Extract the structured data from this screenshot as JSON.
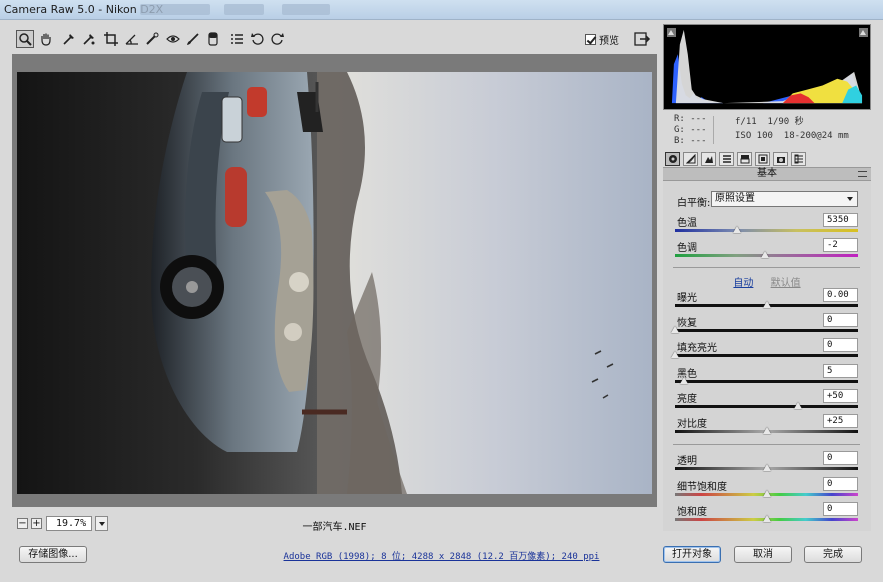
{
  "window": {
    "title": "Camera Raw 5.0 - Nikon D2X"
  },
  "toolbar": {
    "tools": [
      "zoom-tool-icon",
      "hand-tool-icon",
      "white-balance-icon",
      "color-sampler-icon",
      "crop-icon",
      "straighten-icon",
      "spot-removal-icon",
      "red-eye-icon",
      "adjustment-brush-icon",
      "graduated-filter-icon",
      "preferences-icon",
      "rotate-ccw-icon",
      "rotate-cw-icon"
    ],
    "preview_label": "预览",
    "preview_checked": true
  },
  "image": {
    "filename": "一部汽车.NEF"
  },
  "zoom": {
    "minus": "−",
    "plus": "+",
    "value": "19.7%"
  },
  "readout": {
    "r_label": "R:",
    "r_value": "---",
    "g_label": "G:",
    "g_value": "---",
    "b_label": "B:",
    "b_value": "---",
    "aperture": "f/11",
    "shutter": "1/90 秒",
    "iso": "ISO 100",
    "lens": "18-200@24 mm"
  },
  "panel": {
    "title": "基本",
    "white_balance": {
      "label": "白平衡:",
      "value": "原照设置"
    },
    "auto_label": "自动",
    "default_label": "默认值",
    "sliders": [
      {
        "key": "temp",
        "label": "色温",
        "value": "5350",
        "pos": 0.34
      },
      {
        "key": "tint",
        "label": "色调",
        "value": "-2",
        "pos": 0.49
      },
      {
        "key": "exposure",
        "label": "曝光",
        "value": "0.00",
        "pos": 0.5
      },
      {
        "key": "recovery",
        "label": "恢复",
        "value": "0",
        "pos": 0.0
      },
      {
        "key": "fill",
        "label": "填充亮光",
        "value": "0",
        "pos": 0.0
      },
      {
        "key": "blacks",
        "label": "黑色",
        "value": "5",
        "pos": 0.05
      },
      {
        "key": "brightness",
        "label": "亮度",
        "value": "+50",
        "pos": 0.67
      },
      {
        "key": "contrast",
        "label": "对比度",
        "value": "+25",
        "pos": 0.5
      },
      {
        "key": "clarity",
        "label": "透明",
        "value": "0",
        "pos": 0.5
      },
      {
        "key": "vibrance",
        "label": "细节饱和度",
        "value": "0",
        "pos": 0.5
      },
      {
        "key": "saturation",
        "label": "饱和度",
        "value": "0",
        "pos": 0.5
      }
    ]
  },
  "footer": {
    "save_label": "存储图像...",
    "workflow_text": "Adobe RGB (1998); 8 位; 4288 x 2848 (12.2 百万像素); 240 ppi",
    "open_label": "打开对象",
    "cancel_label": "取消",
    "done_label": "完成"
  },
  "colors": {
    "accent": "#3a6fb0",
    "link": "#1a3399"
  }
}
